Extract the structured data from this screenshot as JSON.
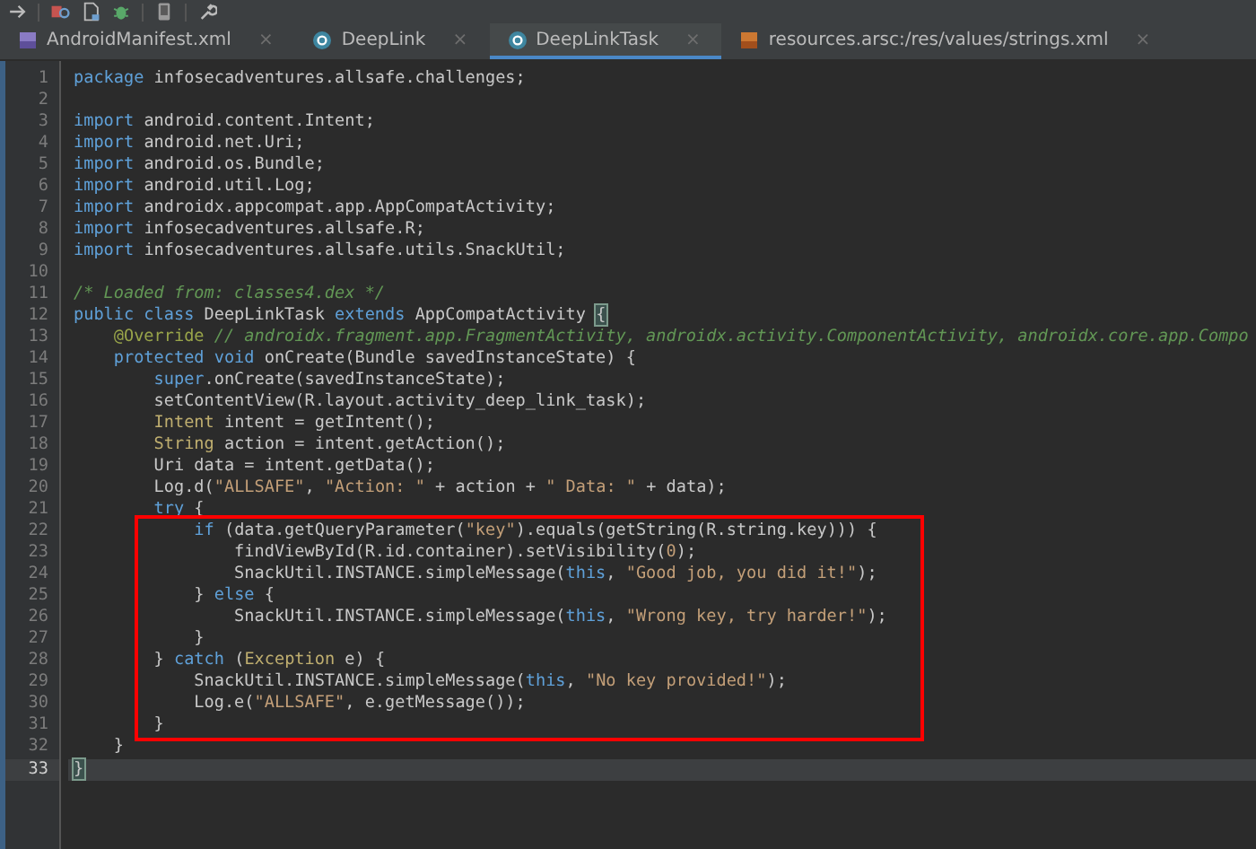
{
  "tabs": [
    {
      "label": "AndroidManifest.xml",
      "kind": "xml",
      "selected": false,
      "close": "×"
    },
    {
      "label": "DeepLink",
      "kind": "class",
      "selected": false,
      "close": "×"
    },
    {
      "label": "DeepLinkTask",
      "kind": "class",
      "selected": true,
      "close": "×"
    },
    {
      "label": "resources.arsc:/res/values/strings.xml",
      "kind": "resource",
      "selected": false,
      "close": "×"
    }
  ],
  "editor": {
    "blocks": [
      {
        "kind": "plain",
        "lines": [
          {
            "number": "1",
            "current": false,
            "tokens": [
              {
                "kind": "keyword",
                "text": "package"
              },
              {
                "kind": "plain",
                "text": " infosecadventures.allsafe.challenges;"
              }
            ]
          },
          {
            "number": "2",
            "current": false
          },
          {
            "number": "3",
            "current": false,
            "tokens": [
              {
                "kind": "keyword",
                "text": "import"
              },
              {
                "kind": "plain",
                "text": " android.content.Intent;"
              }
            ]
          },
          {
            "number": "4",
            "current": false,
            "tokens": [
              {
                "kind": "keyword",
                "text": "import"
              },
              {
                "kind": "plain",
                "text": " android.net.Uri;"
              }
            ]
          },
          {
            "number": "5",
            "current": false,
            "tokens": [
              {
                "kind": "keyword",
                "text": "import"
              },
              {
                "kind": "plain",
                "text": " android.os.Bundle;"
              }
            ]
          },
          {
            "number": "6",
            "current": false,
            "tokens": [
              {
                "kind": "keyword",
                "text": "import"
              },
              {
                "kind": "plain",
                "text": " android.util.Log;"
              }
            ]
          },
          {
            "number": "7",
            "current": false,
            "tokens": [
              {
                "kind": "keyword",
                "text": "import"
              },
              {
                "kind": "plain",
                "text": " androidx.appcompat.app.AppCompatActivity;"
              }
            ]
          },
          {
            "number": "8",
            "current": false,
            "tokens": [
              {
                "kind": "keyword",
                "text": "import"
              },
              {
                "kind": "plain",
                "text": " infosecadventures.allsafe.R;"
              }
            ]
          },
          {
            "number": "9",
            "current": false,
            "tokens": [
              {
                "kind": "keyword",
                "text": "import"
              },
              {
                "kind": "plain",
                "text": " infosecadventures.allsafe.utils.SnackUtil;"
              }
            ]
          },
          {
            "number": "10",
            "current": false
          },
          {
            "number": "11",
            "current": false,
            "tokens": [
              {
                "kind": "comment",
                "text": "/* Loaded from: classes4.dex */"
              }
            ]
          },
          {
            "number": "12",
            "current": false,
            "tokens": [
              {
                "kind": "keyword",
                "text": "public class"
              },
              {
                "kind": "plain",
                "text": " DeepLinkTask "
              },
              {
                "kind": "keyword",
                "text": "extends"
              },
              {
                "kind": "plain",
                "text": " AppCompatActivity "
              },
              {
                "kind": "brace",
                "text": "{"
              }
            ]
          },
          {
            "number": "13",
            "current": false,
            "tokens": [
              {
                "kind": "annotation",
                "text": "    @Override"
              },
              {
                "kind": "comment",
                "text": " // androidx.fragment.app.FragmentActivity, androidx.activity.ComponentActivity, androidx.core.app.Compo"
              }
            ]
          },
          {
            "number": "14",
            "current": false,
            "tokens": [
              {
                "kind": "keyword",
                "text": "    protected void"
              },
              {
                "kind": "plain",
                "text": " onCreate(Bundle savedInstanceState) {"
              }
            ]
          },
          {
            "number": "15",
            "current": false,
            "tokens": [
              {
                "kind": "keyword",
                "text": "        super"
              },
              {
                "kind": "plain",
                "text": ".onCreate(savedInstanceState);"
              }
            ]
          },
          {
            "number": "16",
            "current": false,
            "tokens": [
              {
                "kind": "plain",
                "text": "        setContentView(R.layout.activity_deep_link_task);"
              }
            ]
          },
          {
            "number": "17",
            "current": false,
            "tokens": [
              {
                "kind": "type",
                "text": "        Intent"
              },
              {
                "kind": "plain",
                "text": " intent = getIntent();"
              }
            ]
          },
          {
            "number": "18",
            "current": false,
            "tokens": [
              {
                "kind": "type",
                "text": "        String"
              },
              {
                "kind": "plain",
                "text": " action = intent.getAction();"
              }
            ]
          },
          {
            "number": "19",
            "current": false,
            "tokens": [
              {
                "kind": "plain",
                "text": "        Uri data = intent.getData();"
              }
            ]
          },
          {
            "number": "20",
            "current": false,
            "tokens": [
              {
                "kind": "plain",
                "text": "        Log.d("
              },
              {
                "kind": "string",
                "text": "\"ALLSAFE\""
              },
              {
                "kind": "plain",
                "text": ", "
              },
              {
                "kind": "string",
                "text": "\"Action: \""
              },
              {
                "kind": "plain",
                "text": " + action + "
              },
              {
                "kind": "string",
                "text": "\" Data: \""
              },
              {
                "kind": "plain",
                "text": " + data);"
              }
            ]
          },
          {
            "number": "21",
            "current": false,
            "tokens": [
              {
                "kind": "keyword",
                "text": "        try"
              },
              {
                "kind": "plain",
                "text": " {"
              }
            ]
          }
        ]
      },
      {
        "kind": "boxed",
        "lines": [
          {
            "number": "22",
            "current": false,
            "tokens": [
              {
                "kind": "keyword",
                "text": "            if"
              },
              {
                "kind": "plain",
                "text": " (data.getQueryParameter("
              },
              {
                "kind": "string",
                "text": "\"key\""
              },
              {
                "kind": "plain",
                "text": ").equals(getString(R.string.key))) {"
              }
            ]
          },
          {
            "number": "23",
            "current": false,
            "tokens": [
              {
                "kind": "plain",
                "text": "                findViewById(R.id.container).setVisibility("
              },
              {
                "kind": "number",
                "text": "0"
              },
              {
                "kind": "plain",
                "text": ");"
              }
            ]
          },
          {
            "number": "24",
            "current": false,
            "tokens": [
              {
                "kind": "plain",
                "text": "                SnackUtil.INSTANCE.simpleMessage("
              },
              {
                "kind": "keyword",
                "text": "this"
              },
              {
                "kind": "plain",
                "text": ", "
              },
              {
                "kind": "string",
                "text": "\"Good job, you did it!\""
              },
              {
                "kind": "plain",
                "text": ");"
              }
            ]
          },
          {
            "number": "25",
            "current": false,
            "tokens": [
              {
                "kind": "plain",
                "text": "            } "
              },
              {
                "kind": "keyword",
                "text": "else"
              },
              {
                "kind": "plain",
                "text": " {"
              }
            ]
          },
          {
            "number": "26",
            "current": false,
            "tokens": [
              {
                "kind": "plain",
                "text": "                SnackUtil.INSTANCE.simpleMessage("
              },
              {
                "kind": "keyword",
                "text": "this"
              },
              {
                "kind": "plain",
                "text": ", "
              },
              {
                "kind": "string",
                "text": "\"Wrong key, try harder!\""
              },
              {
                "kind": "plain",
                "text": ");"
              }
            ]
          },
          {
            "number": "27",
            "current": false,
            "tokens": [
              {
                "kind": "plain",
                "text": "            }"
              }
            ]
          },
          {
            "number": "28",
            "current": false,
            "tokens": [
              {
                "kind": "plain",
                "text": "        } "
              },
              {
                "kind": "keyword",
                "text": "catch"
              },
              {
                "kind": "plain",
                "text": " ("
              },
              {
                "kind": "type",
                "text": "Exception"
              },
              {
                "kind": "plain",
                "text": " e) {"
              }
            ]
          },
          {
            "number": "29",
            "current": false,
            "tokens": [
              {
                "kind": "plain",
                "text": "            SnackUtil.INSTANCE.simpleMessage("
              },
              {
                "kind": "keyword",
                "text": "this"
              },
              {
                "kind": "plain",
                "text": ", "
              },
              {
                "kind": "string",
                "text": "\"No key provided!\""
              },
              {
                "kind": "plain",
                "text": ");"
              }
            ]
          },
          {
            "number": "30",
            "current": false,
            "tokens": [
              {
                "kind": "plain",
                "text": "            Log.e("
              },
              {
                "kind": "string",
                "text": "\"ALLSAFE\""
              },
              {
                "kind": "plain",
                "text": ", e.getMessage());"
              }
            ]
          },
          {
            "number": "31",
            "current": false,
            "tokens": [
              {
                "kind": "plain",
                "text": "        }"
              }
            ]
          }
        ]
      },
      {
        "kind": "plain",
        "lines": [
          {
            "number": "32",
            "current": false,
            "tokens": [
              {
                "kind": "plain",
                "text": "    }"
              }
            ]
          },
          {
            "number": "33",
            "current": true,
            "tokens": [
              {
                "kind": "brace",
                "text": "}"
              }
            ]
          }
        ]
      }
    ]
  }
}
